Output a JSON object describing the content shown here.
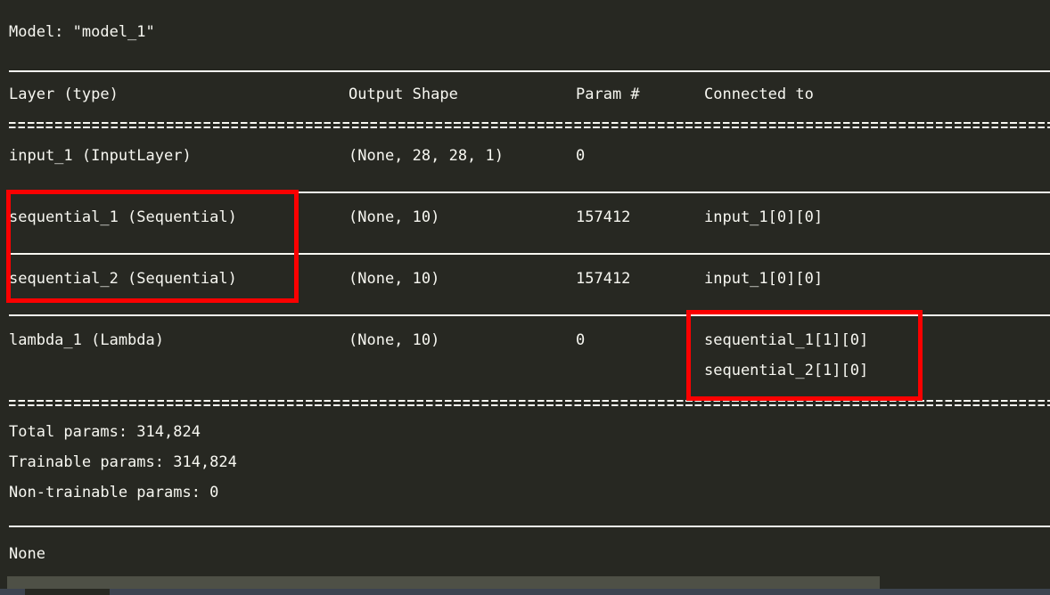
{
  "console": {
    "model_header": "Model: \"model_1\"",
    "columns": {
      "layer": "Layer (type)",
      "output_shape": "Output Shape",
      "param": "Param #",
      "connected_to": "Connected to"
    },
    "rows": [
      {
        "layer": "input_1 (InputLayer)",
        "output_shape": "(None, 28, 28, 1)",
        "param": "0",
        "connected_to": [
          "",
          ""
        ]
      },
      {
        "layer": "sequential_1 (Sequential)",
        "output_shape": "(None, 10)",
        "param": "157412",
        "connected_to": [
          "input_1[0][0]",
          ""
        ]
      },
      {
        "layer": "sequential_2 (Sequential)",
        "output_shape": "(None, 10)",
        "param": "157412",
        "connected_to": [
          "input_1[0][0]",
          ""
        ]
      },
      {
        "layer": "lambda_1 (Lambda)",
        "output_shape": "(None, 10)",
        "param": "0",
        "connected_to": [
          "sequential_1[1][0]",
          "sequential_2[1][0]"
        ]
      }
    ],
    "totals": {
      "total": "Total params: 314,824",
      "trainable": "Trainable params: 314,824",
      "non_trainable": "Non-trainable params: 0"
    },
    "return_value": "None"
  },
  "annotations": {
    "box_sequential_layers": "sequential_1 / sequential_2 layer names highlighted",
    "box_connected_to": "lambda_1 connected-to entries highlighted",
    "color": "#fb0000"
  },
  "theme": {
    "background": "#272822",
    "foreground": "#f7f7f1",
    "scrollbar_thumb": "#4e5046",
    "status_strip": "#3d4450"
  }
}
